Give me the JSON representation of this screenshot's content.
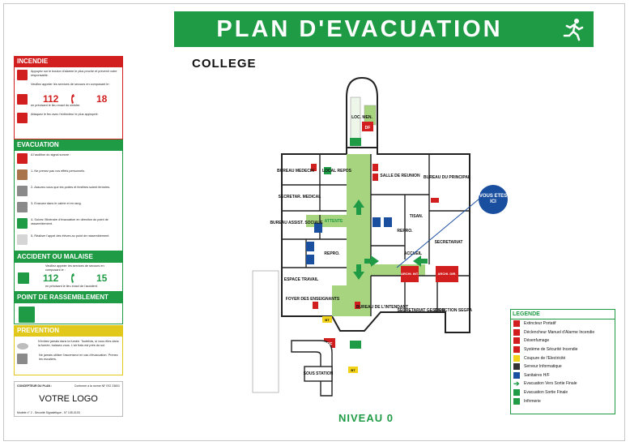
{
  "title": "PLAN D'EVACUATION",
  "subtitle": "COLLEGE",
  "level_label": "NIVEAU 0",
  "vous_etes_ici": "VOUS ETES ICI",
  "colors": {
    "green": "#1f9b45",
    "red": "#d11e1e",
    "yellow": "#e2c81a",
    "blue": "#1a4fa0",
    "corridor": "#a7d47e"
  },
  "incendie": {
    "header": "INCENDIE",
    "items": [
      "Appuyez sur le bouton d'alarme le plus proche et prévenir votre responsable.",
      "Veuillez appeler les services de secours en composant le :",
      "en précisant le lieu exact du sinistre.",
      "Attaquez le feu avec l'extincteur le plus approprié."
    ],
    "num_left": "112",
    "num_right": "18"
  },
  "evacuation": {
    "header": "EVACUATION",
    "items": [
      "A l'audition du signal sonore :",
      "1- Ne prenez pas vos effets personnels.",
      "2- Assurez-vous que les portes et fenêtres soient fermées.",
      "3- Evacuez dans le calme et en rang.",
      "4- Suivez l'itinéraire d'évacuation en direction du point de rassemblement.",
      "5- Réaliser l'appel des élèves au point de rassemblement."
    ]
  },
  "accident": {
    "header": "ACCIDENT OU MALAISE",
    "text1": "Veuillez appeler les services de secours en composant le :",
    "text2": "en précisant le lieu exact de l'accident.",
    "num_left": "112",
    "num_right": "15"
  },
  "rassemblement": {
    "header": "POINT DE RASSEMBLEMENT"
  },
  "prevention": {
    "header": "PREVENTION",
    "item1": "N'entrez jamais dans la fumée. Toutefois, si vous êtes dans la fumée, baissez-vous. L'air frais est près du sol.",
    "item2": "Ne jamais utiliser l'ascenseur en cas d'évacuation. Prenez les escaliers."
  },
  "logo_box": {
    "concepteur": "CONCEPTEUR DU PLAN :",
    "conforme": "Conforme à la norme NF ISO 23601",
    "logo": "VOTRE LOGO",
    "footer": "Modèle n° 2 - Sécurité Signalétique - N° 105-0103"
  },
  "rooms": {
    "loc_men": "LOC. MEN.",
    "bureau_medecin": "BUREAU MEDECIN",
    "local_repos": "LOCAL REPOS",
    "salle_reunion": "SALLE DE REUNION",
    "bureau_principal": "BUREAU DU PRINCIPAL",
    "secretariat_medical": "SECRETAR. MEDICAL",
    "attente": "ATTENTE",
    "bureau_assist": "BUREAU ASSIST. SOCIALE",
    "tisan": "TISAN.",
    "repro_right": "REPRO.",
    "secretariat": "SECRETARIAT",
    "repro_left": "REPRO.",
    "accueil": "ACCUEIL",
    "espace_travail": "ESPACE TRAVAIL",
    "foyer": "FOYER DES ENSEIGNANTS",
    "bureau_intendant": "BUREAU DE L'INTENDANT",
    "secretariat_gestion": "SECRETARIAT GESTION",
    "direction_segpa": "DIRECTION SEGPA",
    "archives1": "ARCHI. INT.",
    "archives2": "ARCHI. DIR.",
    "sous_station": "SOUS STATION",
    "df": "DF",
    "bt": "BT",
    "si": "SSI"
  },
  "legend": {
    "title": "LEGENDE",
    "items": [
      {
        "icon": "extinguisher-icon",
        "label": "Extincteur Portatif"
      },
      {
        "icon": "alarm-button-icon",
        "label": "Déclencheur Manuel d'Alarme Incendie"
      },
      {
        "icon": "smoke-vent-icon",
        "label": "Désenfumage"
      },
      {
        "icon": "ssi-icon",
        "label": "Système de Sécurité Incendie"
      },
      {
        "icon": "power-cut-icon",
        "label": "Coupure de l'Electricité"
      },
      {
        "icon": "server-icon",
        "label": "Serveur Informatique"
      },
      {
        "icon": "toilets-icon",
        "label": "Sanitaires H/F"
      },
      {
        "icon": "arrow-icon",
        "label": "Evacuation Vers Sortie Finale"
      },
      {
        "icon": "exit-icon",
        "label": "Evacuation Sortie Finale"
      },
      {
        "icon": "first-aid-icon",
        "label": "Infirmerie"
      }
    ]
  }
}
